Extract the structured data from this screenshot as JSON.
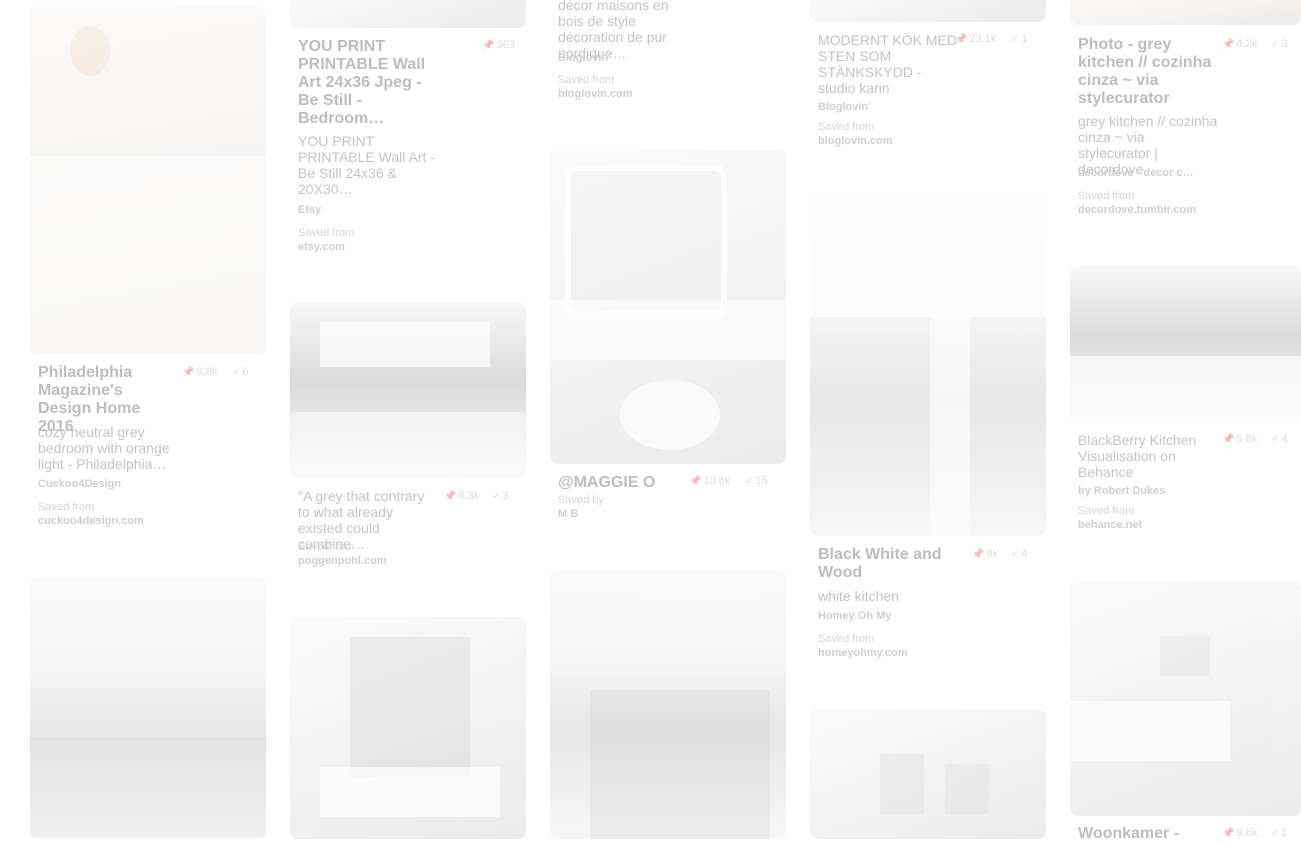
{
  "pins": [
    {
      "id": "p1",
      "title": "Philadelphia Magazine's Design Home 2016",
      "repins": "9.8k",
      "likes": "6",
      "description": "cozy neutral grey bedroom with orange light - Philadelphia…",
      "source": "Cuckoo4Design",
      "saved_label": "Saved from",
      "domain": "cuckoo4design.com"
    },
    {
      "id": "p2",
      "title": "YOU PRINT PRINTABLE Wall Art 24x36 Jpeg - Be Still - Bedroom…",
      "repins": "363",
      "description": "YOU PRINT PRINTABLE Wall Art - Be Still 24x36 & 20X30…",
      "source": "Etsy",
      "saved_label": "Saved from",
      "domain": "etsy.com"
    },
    {
      "id": "p3",
      "description": "\"A grey that contrary to what already existed could combine…",
      "repins": "8.3k",
      "likes": "3",
      "saved_label": "Saved from",
      "domain": "poggenpohl.com"
    },
    {
      "id": "p4",
      "description_partial": "décor maisons en bois de style décoration de pur nordique…",
      "source": "Bloglovin'",
      "saved_label": "Saved from",
      "domain": "bloglovin.com"
    },
    {
      "id": "p5",
      "title": "@MAGGIE O",
      "repins": "10.6k",
      "likes": "15",
      "saved_label": "Saved by",
      "saver": "M B"
    },
    {
      "id": "p6",
      "title_plain": "MODERNT KÖK MED STEN SOM STÄNKSKYDD - studio karin",
      "repins": "23.1k",
      "likes": "1",
      "source": "Bloglovin'",
      "saved_label": "Saved from",
      "domain": "bloglovin.com"
    },
    {
      "id": "p7",
      "title": "Black White and Wood",
      "repins": "9k",
      "likes": "4",
      "description": "white kitchen",
      "source": "Homey Oh My",
      "saved_label": "Saved from",
      "domain": "homeyohmy.com"
    },
    {
      "id": "p8",
      "title": "Photo - grey kitchen // cozinha cinza ~ via stylecurator",
      "repins": "4.2k",
      "likes": "3",
      "description": "grey kitchen // cozinha cinza ~ via stylecurator | decordove",
      "source": "decordove - decor c…",
      "saved_label": "Saved from",
      "domain": "decordove.tumblr.com"
    },
    {
      "id": "p9",
      "title_plain": "BlackBerry Kitchen Visualisation on Behance",
      "repins": "5.8k",
      "likes": "4",
      "source": "by Robert Dukes",
      "saved_label": "Saved from",
      "domain": "behance.net"
    },
    {
      "id": "p10",
      "title": "Woonkamer -",
      "repins": "9.6k",
      "likes": "1"
    }
  ],
  "icons": {
    "repin": "pin-icon",
    "like": "check-icon"
  },
  "colors": {
    "background": "#ffffff",
    "text": "#333333",
    "muted": "#999999"
  }
}
